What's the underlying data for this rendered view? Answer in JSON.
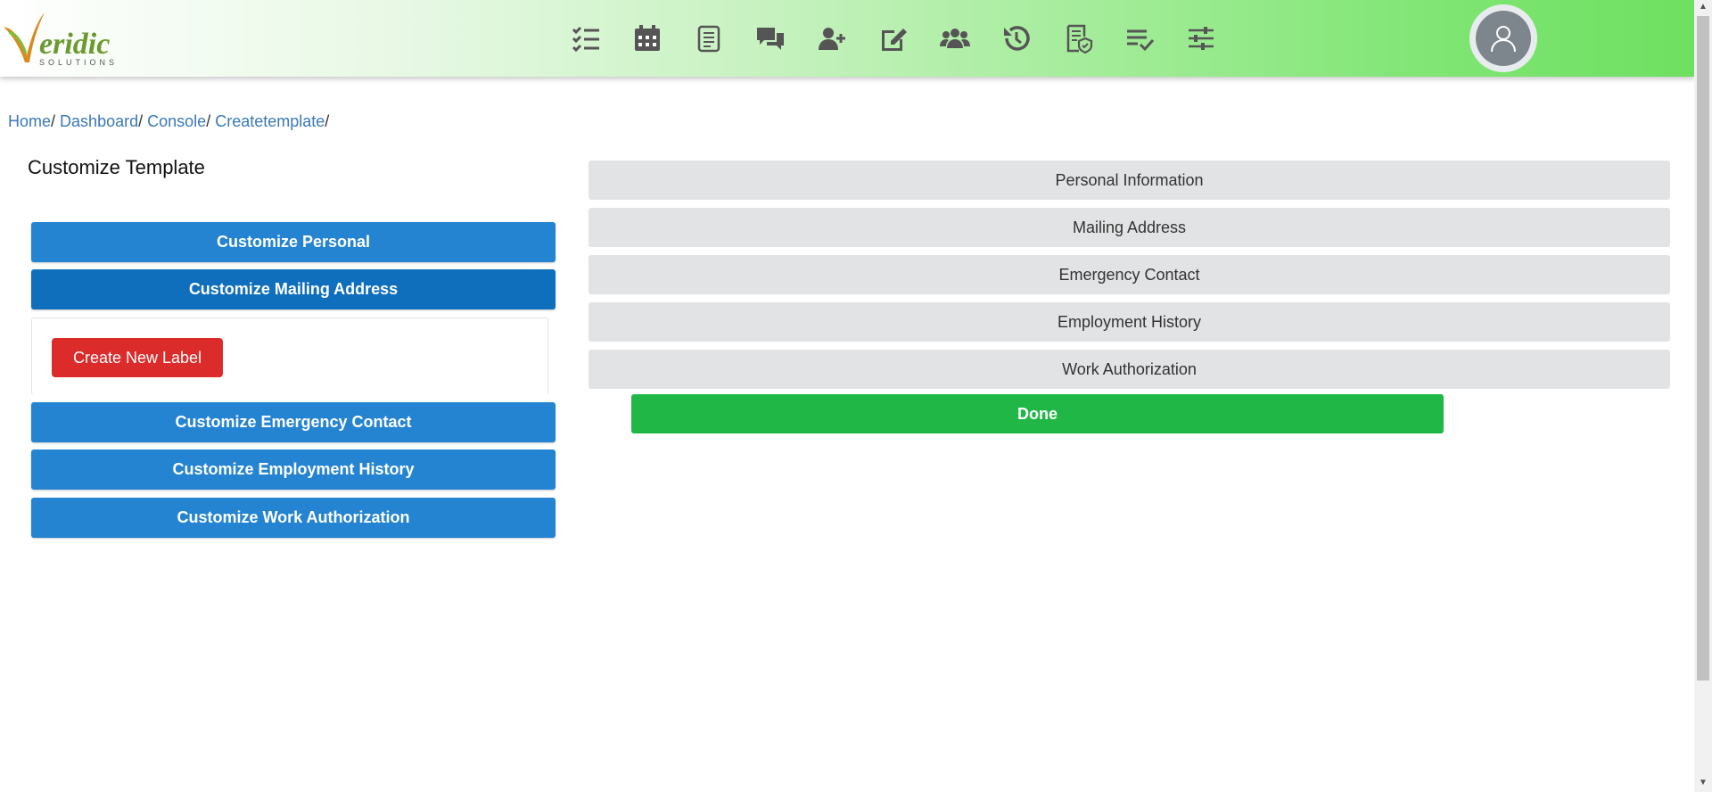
{
  "header": {
    "logo_text": "Veridic",
    "logo_subtext": "SOLUTIONS",
    "icons": [
      "checklist-icon",
      "calendar-icon",
      "document-icon",
      "chat-icon",
      "add-user-icon",
      "edit-icon",
      "users-icon",
      "history-icon",
      "certificate-icon",
      "tasks-done-icon",
      "settings-sliders-icon"
    ],
    "avatar_icon": "user-avatar-icon",
    "icon_color": "#555555"
  },
  "breadcrumb": {
    "home": "Home",
    "dashboard": "Dashboard",
    "console": "Console",
    "createtemplate": "Createtemplate",
    "separator": "/"
  },
  "left_panel": {
    "title": "Customize Template",
    "buttons": {
      "personal": "Customize Personal",
      "mailing": "Customize Mailing Address",
      "emergency": "Customize Emergency Contact",
      "employment": "Customize Employment History",
      "work_auth": "Customize Work Authorization"
    },
    "create_label": "Create New Label"
  },
  "right_panel": {
    "sections": {
      "personal": "Personal Information",
      "mailing": "Mailing Address",
      "emergency": "Emergency Contact",
      "employment": "Employment History",
      "work_auth": "Work Authorization"
    },
    "done": "Done"
  },
  "colors": {
    "primary_blue": "#2484d2",
    "active_blue": "#0f6fbd",
    "danger_red": "#dc2b2b",
    "success_green": "#21b746",
    "section_gray": "#e2e3e5",
    "link_blue": "#3a78b8"
  }
}
